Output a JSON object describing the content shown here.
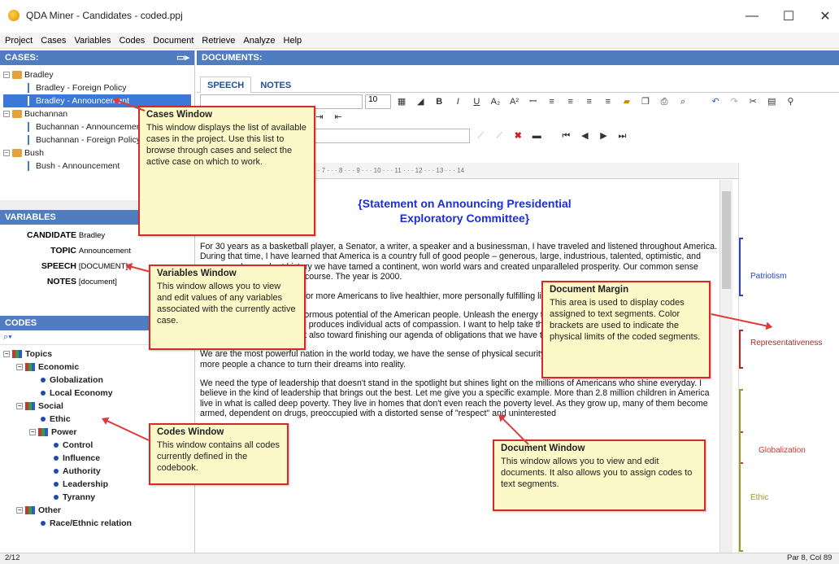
{
  "window": {
    "title": "QDA Miner - Candidates - coded.ppj",
    "minimize": "—",
    "maximize": "☐",
    "close": "✕"
  },
  "menu": [
    "Project",
    "Cases",
    "Variables",
    "Codes",
    "Document",
    "Retrieve",
    "Analyze",
    "Help"
  ],
  "cases": {
    "header": "CASES:",
    "items": [
      {
        "label": "Bradley",
        "type": "group"
      },
      {
        "label": "Bradley - Foreign Policy",
        "type": "case"
      },
      {
        "label": "Bradley - Announcement",
        "type": "case",
        "selected": true
      },
      {
        "label": "Buchannan",
        "type": "group"
      },
      {
        "label": "Buchannan - Announcement",
        "type": "case"
      },
      {
        "label": "Buchannan - Foreign Policy",
        "type": "case"
      },
      {
        "label": "Bush",
        "type": "group"
      },
      {
        "label": "Bush - Announcement",
        "type": "case"
      }
    ]
  },
  "variables": {
    "header": "VARIABLES",
    "rows": [
      {
        "name": "CANDIDATE",
        "value": "Bradley"
      },
      {
        "name": "TOPIC",
        "value": "Announcement"
      },
      {
        "name": "SPEECH",
        "value": "[DOCUMENT]"
      },
      {
        "name": "NOTES",
        "value": "[document]"
      }
    ]
  },
  "codes": {
    "header": "CODES",
    "items": [
      {
        "label": "Topics",
        "kind": "category",
        "level": 0
      },
      {
        "label": "Economic",
        "kind": "category",
        "level": 1
      },
      {
        "label": "Globalization",
        "kind": "code",
        "level": 2
      },
      {
        "label": "Local Economy",
        "kind": "code",
        "level": 2
      },
      {
        "label": "Social",
        "kind": "category",
        "level": 1
      },
      {
        "label": "Ethic",
        "kind": "code",
        "level": 2
      },
      {
        "label": "Power",
        "kind": "category",
        "level": 2
      },
      {
        "label": "Control",
        "kind": "code",
        "level": 3
      },
      {
        "label": "Influence",
        "kind": "code",
        "level": 3
      },
      {
        "label": "Authority",
        "kind": "code",
        "level": 3
      },
      {
        "label": "Leadership",
        "kind": "code",
        "level": 3
      },
      {
        "label": "Tyranny",
        "kind": "code",
        "level": 3
      },
      {
        "label": "Other",
        "kind": "category",
        "level": 1
      },
      {
        "label": "Race/Ethnic relation",
        "kind": "code",
        "level": 2
      }
    ]
  },
  "documents": {
    "header": "DOCUMENTS:",
    "tabs": [
      "SPEECH",
      "NOTES"
    ],
    "font_size": "10"
  },
  "ruler_text": "· · · 1 · · · 2 · · · 3 · · · 4 · · · 5 · · · 6 · · · 7 · · · 8 · · · 9 · · · 10 · · · 11 · · · 12 · · · 13 · · · 14",
  "doc": {
    "title_line1": "{Statement on Announcing Presidential",
    "title_line2": "Exploratory Committee}",
    "paragraphs": [
      "For 30 years as a basketball player, a Senator, a writer, a speaker and a businessman, I have traveled and listened throughout America. During that time, I have learned that America is a country full of good people – generous, large, industrious, talented, optimistic, and generous. In our short history we have tamed a continent, won world wars and created unparalleled prosperity. Our common sense usually puts us on the right course. The year is 2000.",
      "I want to make opportunity for more Americans to live healthier, more personally fulfilling lives.",
      "I run to help unleash the enormous potential of the American people. Unleash the energy that makes our economy move, fuels our technological advances and produces individual acts of compassion. I want to help take that energy and channel it, not only toward further economic vitality, but also toward finishing our agenda of obligations that we have to one another.",
      "We are the most powerful nation in the world today, we have the sense of physical security against blatant aggression. I want to give more people a chance to turn their dreams into reality.",
      "We need the type of leadership that doesn't stand in the spotlight but shines light on the millions of Americans who shine everyday. I believe in the kind of leadership that brings out the best. Let me give you a specific example. More than 2.8 million children in America live in what is called deep poverty. They live in homes that don't even reach the poverty level. As they grow up, many of them become armed, dependent on drugs, preoccupied with a distorted sense of \"respect\" and uninterested"
    ]
  },
  "margin_codes": [
    {
      "label": "Patriotism",
      "color": "#2a3fe0"
    },
    {
      "label": "Representativeness",
      "color": "#b02a2a"
    },
    {
      "label": "Globalization",
      "color": "#e03030"
    },
    {
      "label": "Ethic",
      "color": "#9a9a2a"
    }
  ],
  "callouts": {
    "cases": {
      "title": "Cases Window",
      "text": "This window displays the list of available cases in the project. Use this list to browse through cases and select the active case on which to work."
    },
    "variables": {
      "title": "Variables Window",
      "text": "This window allows you to view and edit values of any variables associated with the currently active case."
    },
    "codes": {
      "title": "Codes Window",
      "text": "This window contains all codes currently defined in the codebook."
    },
    "margin": {
      "title": "Document Margin",
      "text": "This area is used to display codes assigned to text segments. Color brackets are used to indicate the physical limits of the coded segments."
    },
    "document": {
      "title": "Document Window",
      "text": "This window allows you to view and edit documents. It also allows you to assign codes to text segments."
    }
  },
  "status": {
    "left": "2/12",
    "right": "Par 8, Col 89"
  }
}
